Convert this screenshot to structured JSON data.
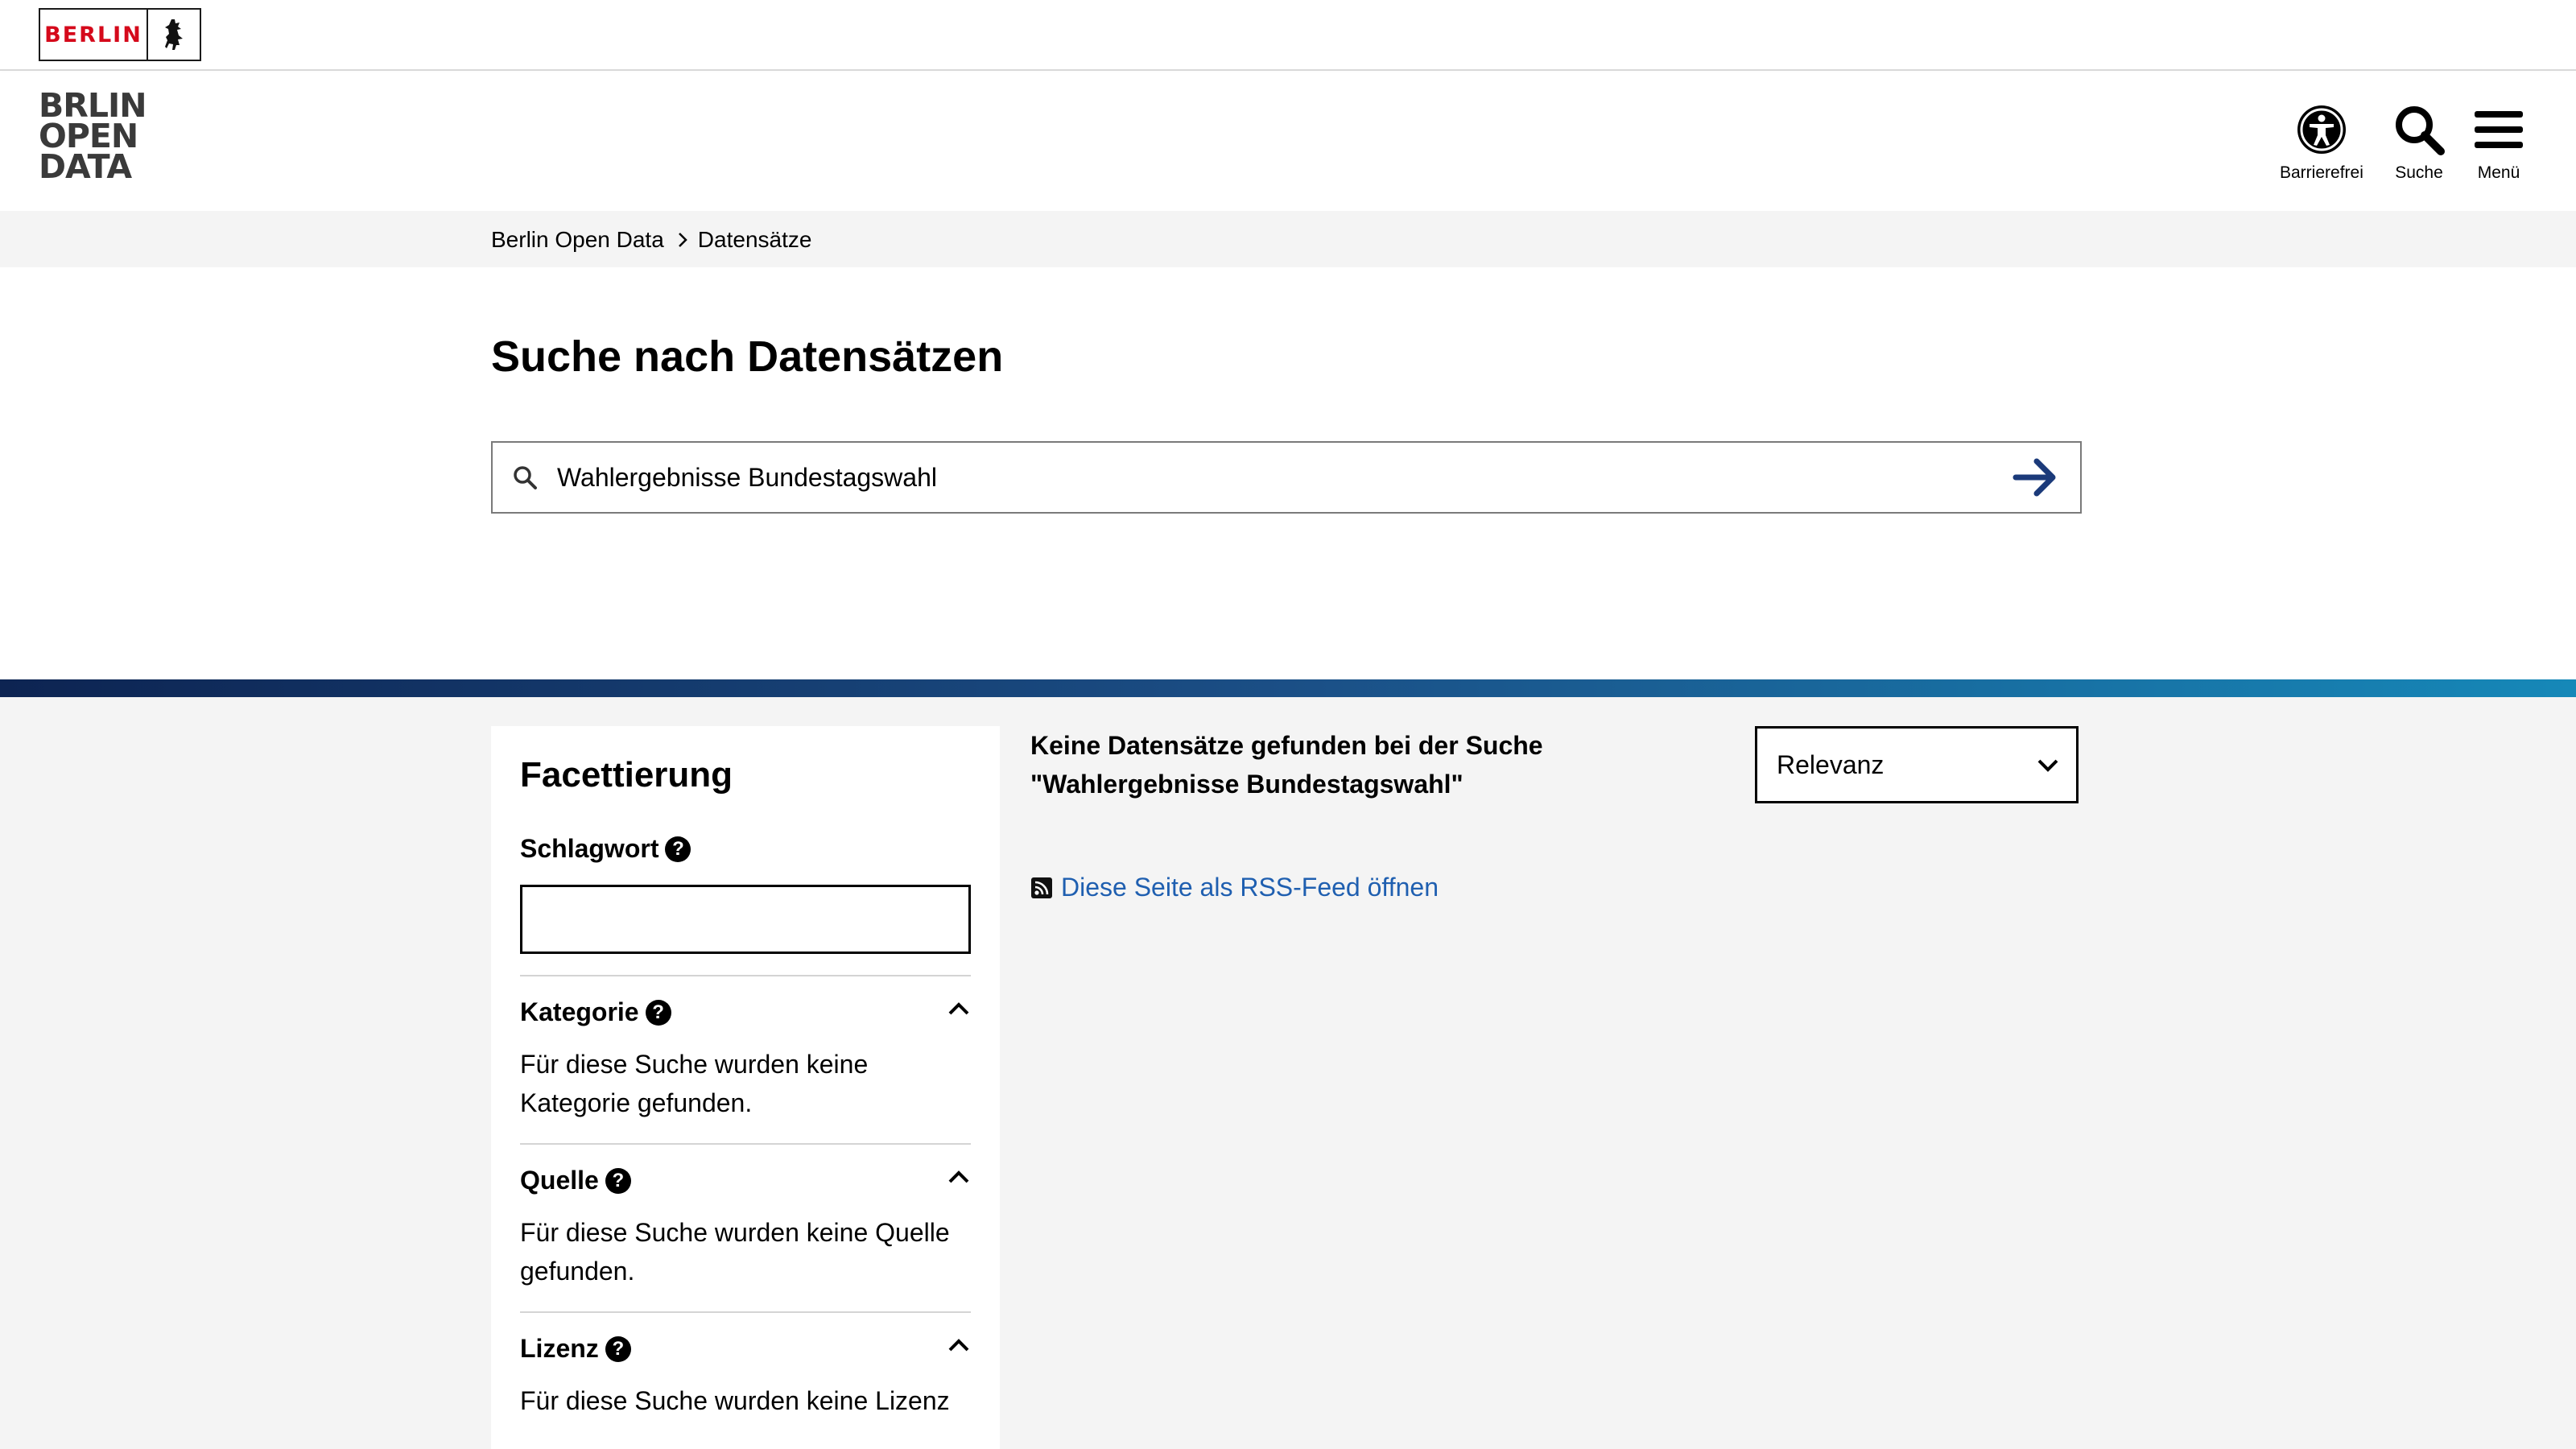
{
  "topbar": {
    "berlin_logo_text": "BERLIN"
  },
  "header": {
    "logo_lines": [
      "BRLIN",
      "OPEN",
      "DATA"
    ],
    "accessibility_label": "Barrierefrei",
    "search_label": "Suche",
    "menu_label": "Menü"
  },
  "breadcrumb": {
    "items": [
      "Berlin Open Data",
      "Datensätze"
    ]
  },
  "main": {
    "title": "Suche nach Datensätzen",
    "search_value": "Wahlergebnisse Bundestagswahl"
  },
  "facets": {
    "title": "Facettierung",
    "keyword_label": "Schlagwort",
    "keyword_value": "",
    "sections": [
      {
        "label": "Kategorie",
        "text": "Für diese Suche wurden keine Kategorie gefunden."
      },
      {
        "label": "Quelle",
        "text": "Für diese Suche wurden keine Quelle gefunden."
      },
      {
        "label": "Lizenz",
        "text": "Für diese Suche wurden keine Lizenz"
      }
    ]
  },
  "results": {
    "no_results_line1": "Keine Datensätze gefunden bei der Suche",
    "no_results_line2": "\"Wahlergebnisse Bundestagswahl\"",
    "sort_value": "Relevanz",
    "rss_link": "Diese Seite als RSS-Feed öffnen"
  },
  "colors": {
    "berlin_red": "#d5091b",
    "link_blue": "#1f5fb0",
    "arrow_navy": "#1b3a7a",
    "gradient_start": "#0d2452",
    "gradient_end": "#1688b8"
  }
}
